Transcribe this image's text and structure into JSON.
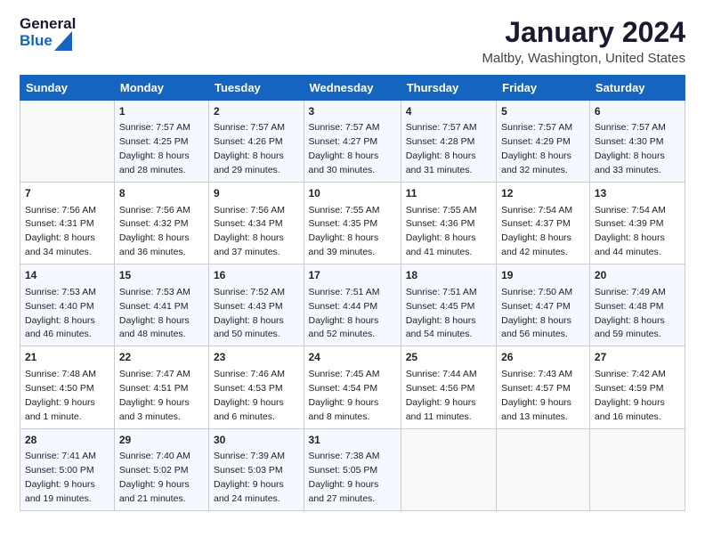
{
  "header": {
    "logo_general": "General",
    "logo_blue": "Blue",
    "main_title": "January 2024",
    "sub_title": "Maltby, Washington, United States"
  },
  "days_of_week": [
    "Sunday",
    "Monday",
    "Tuesday",
    "Wednesday",
    "Thursday",
    "Friday",
    "Saturday"
  ],
  "weeks": [
    [
      {
        "day": "",
        "sunrise": "",
        "sunset": "",
        "daylight": ""
      },
      {
        "day": "1",
        "sunrise": "Sunrise: 7:57 AM",
        "sunset": "Sunset: 4:25 PM",
        "daylight": "Daylight: 8 hours and 28 minutes."
      },
      {
        "day": "2",
        "sunrise": "Sunrise: 7:57 AM",
        "sunset": "Sunset: 4:26 PM",
        "daylight": "Daylight: 8 hours and 29 minutes."
      },
      {
        "day": "3",
        "sunrise": "Sunrise: 7:57 AM",
        "sunset": "Sunset: 4:27 PM",
        "daylight": "Daylight: 8 hours and 30 minutes."
      },
      {
        "day": "4",
        "sunrise": "Sunrise: 7:57 AM",
        "sunset": "Sunset: 4:28 PM",
        "daylight": "Daylight: 8 hours and 31 minutes."
      },
      {
        "day": "5",
        "sunrise": "Sunrise: 7:57 AM",
        "sunset": "Sunset: 4:29 PM",
        "daylight": "Daylight: 8 hours and 32 minutes."
      },
      {
        "day": "6",
        "sunrise": "Sunrise: 7:57 AM",
        "sunset": "Sunset: 4:30 PM",
        "daylight": "Daylight: 8 hours and 33 minutes."
      }
    ],
    [
      {
        "day": "7",
        "sunrise": "Sunrise: 7:56 AM",
        "sunset": "Sunset: 4:31 PM",
        "daylight": "Daylight: 8 hours and 34 minutes."
      },
      {
        "day": "8",
        "sunrise": "Sunrise: 7:56 AM",
        "sunset": "Sunset: 4:32 PM",
        "daylight": "Daylight: 8 hours and 36 minutes."
      },
      {
        "day": "9",
        "sunrise": "Sunrise: 7:56 AM",
        "sunset": "Sunset: 4:34 PM",
        "daylight": "Daylight: 8 hours and 37 minutes."
      },
      {
        "day": "10",
        "sunrise": "Sunrise: 7:55 AM",
        "sunset": "Sunset: 4:35 PM",
        "daylight": "Daylight: 8 hours and 39 minutes."
      },
      {
        "day": "11",
        "sunrise": "Sunrise: 7:55 AM",
        "sunset": "Sunset: 4:36 PM",
        "daylight": "Daylight: 8 hours and 41 minutes."
      },
      {
        "day": "12",
        "sunrise": "Sunrise: 7:54 AM",
        "sunset": "Sunset: 4:37 PM",
        "daylight": "Daylight: 8 hours and 42 minutes."
      },
      {
        "day": "13",
        "sunrise": "Sunrise: 7:54 AM",
        "sunset": "Sunset: 4:39 PM",
        "daylight": "Daylight: 8 hours and 44 minutes."
      }
    ],
    [
      {
        "day": "14",
        "sunrise": "Sunrise: 7:53 AM",
        "sunset": "Sunset: 4:40 PM",
        "daylight": "Daylight: 8 hours and 46 minutes."
      },
      {
        "day": "15",
        "sunrise": "Sunrise: 7:53 AM",
        "sunset": "Sunset: 4:41 PM",
        "daylight": "Daylight: 8 hours and 48 minutes."
      },
      {
        "day": "16",
        "sunrise": "Sunrise: 7:52 AM",
        "sunset": "Sunset: 4:43 PM",
        "daylight": "Daylight: 8 hours and 50 minutes."
      },
      {
        "day": "17",
        "sunrise": "Sunrise: 7:51 AM",
        "sunset": "Sunset: 4:44 PM",
        "daylight": "Daylight: 8 hours and 52 minutes."
      },
      {
        "day": "18",
        "sunrise": "Sunrise: 7:51 AM",
        "sunset": "Sunset: 4:45 PM",
        "daylight": "Daylight: 8 hours and 54 minutes."
      },
      {
        "day": "19",
        "sunrise": "Sunrise: 7:50 AM",
        "sunset": "Sunset: 4:47 PM",
        "daylight": "Daylight: 8 hours and 56 minutes."
      },
      {
        "day": "20",
        "sunrise": "Sunrise: 7:49 AM",
        "sunset": "Sunset: 4:48 PM",
        "daylight": "Daylight: 8 hours and 59 minutes."
      }
    ],
    [
      {
        "day": "21",
        "sunrise": "Sunrise: 7:48 AM",
        "sunset": "Sunset: 4:50 PM",
        "daylight": "Daylight: 9 hours and 1 minute."
      },
      {
        "day": "22",
        "sunrise": "Sunrise: 7:47 AM",
        "sunset": "Sunset: 4:51 PM",
        "daylight": "Daylight: 9 hours and 3 minutes."
      },
      {
        "day": "23",
        "sunrise": "Sunrise: 7:46 AM",
        "sunset": "Sunset: 4:53 PM",
        "daylight": "Daylight: 9 hours and 6 minutes."
      },
      {
        "day": "24",
        "sunrise": "Sunrise: 7:45 AM",
        "sunset": "Sunset: 4:54 PM",
        "daylight": "Daylight: 9 hours and 8 minutes."
      },
      {
        "day": "25",
        "sunrise": "Sunrise: 7:44 AM",
        "sunset": "Sunset: 4:56 PM",
        "daylight": "Daylight: 9 hours and 11 minutes."
      },
      {
        "day": "26",
        "sunrise": "Sunrise: 7:43 AM",
        "sunset": "Sunset: 4:57 PM",
        "daylight": "Daylight: 9 hours and 13 minutes."
      },
      {
        "day": "27",
        "sunrise": "Sunrise: 7:42 AM",
        "sunset": "Sunset: 4:59 PM",
        "daylight": "Daylight: 9 hours and 16 minutes."
      }
    ],
    [
      {
        "day": "28",
        "sunrise": "Sunrise: 7:41 AM",
        "sunset": "Sunset: 5:00 PM",
        "daylight": "Daylight: 9 hours and 19 minutes."
      },
      {
        "day": "29",
        "sunrise": "Sunrise: 7:40 AM",
        "sunset": "Sunset: 5:02 PM",
        "daylight": "Daylight: 9 hours and 21 minutes."
      },
      {
        "day": "30",
        "sunrise": "Sunrise: 7:39 AM",
        "sunset": "Sunset: 5:03 PM",
        "daylight": "Daylight: 9 hours and 24 minutes."
      },
      {
        "day": "31",
        "sunrise": "Sunrise: 7:38 AM",
        "sunset": "Sunset: 5:05 PM",
        "daylight": "Daylight: 9 hours and 27 minutes."
      },
      {
        "day": "",
        "sunrise": "",
        "sunset": "",
        "daylight": ""
      },
      {
        "day": "",
        "sunrise": "",
        "sunset": "",
        "daylight": ""
      },
      {
        "day": "",
        "sunrise": "",
        "sunset": "",
        "daylight": ""
      }
    ]
  ]
}
